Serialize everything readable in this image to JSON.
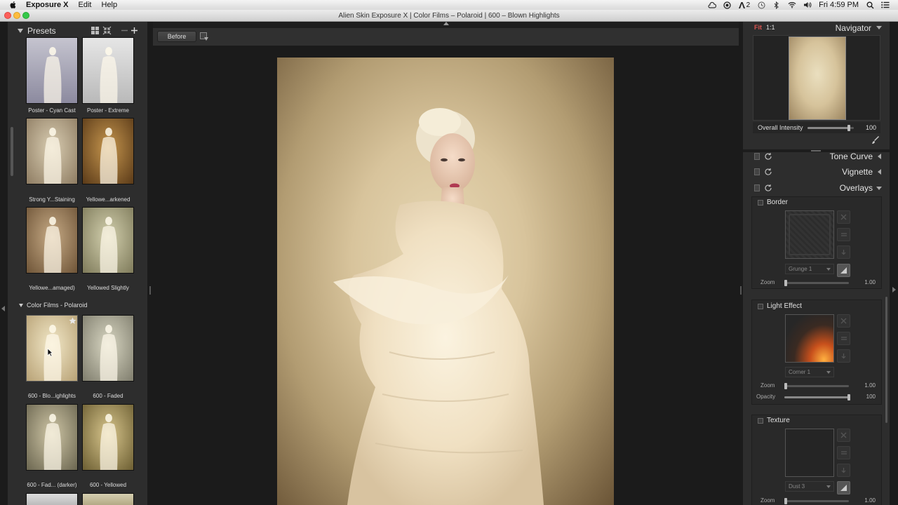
{
  "menubar": {
    "app_name": "Exposure X",
    "menus": [
      "Edit",
      "Help"
    ],
    "tray_number": "2",
    "clock": "Fri 4:59 PM"
  },
  "window": {
    "title": "Alien Skin Exposure X | Color Films – Polaroid | 600 – Blown Highlights"
  },
  "presets": {
    "title": "Presets",
    "top_rows": [
      {
        "left": "Poster - Cyan Cast",
        "right": "Poster - Extreme"
      },
      {
        "left": "Strong Y...Staining",
        "right": "Yellowe...arkened"
      },
      {
        "left": "Yellowe...amaged)",
        "right": "Yellowed Slightly"
      }
    ],
    "section_name": "Color Films - Polaroid",
    "section_rows": [
      {
        "left": "600 - Blo...ighlights",
        "right": "600 - Faded"
      },
      {
        "left": "600 - Fad... (darker)",
        "right": "600 - Yellowed"
      }
    ]
  },
  "toolbar": {
    "before_label": "Before"
  },
  "navigator": {
    "fit_label": "Fit",
    "ratio_label": "1:1",
    "title": "Navigator",
    "intensity_label": "Overall Intensity",
    "intensity_value": "100",
    "intensity_level": 0.9
  },
  "sections": {
    "tone_curve": "Tone Curve",
    "vignette": "Vignette",
    "overlays": "Overlays"
  },
  "overlays": {
    "border": {
      "title": "Border",
      "preset": "Grunge 1",
      "zoom_label": "Zoom",
      "zoom_value": "1.00",
      "zoom_level": 0.0
    },
    "light_effect": {
      "title": "Light Effect",
      "preset": "Corner 1",
      "zoom_label": "Zoom",
      "zoom_value": "1.00",
      "zoom_level": 0.0,
      "opacity_label": "Opacity",
      "opacity_value": "100",
      "opacity_level": 1.0
    },
    "texture": {
      "title": "Texture",
      "preset": "Dust 3",
      "zoom_label": "Zoom",
      "zoom_value": "1.00",
      "zoom_level": 0.0
    }
  },
  "colors": {
    "accent_fit": "#d9534f",
    "panel_bg": "#2d2d2d",
    "canvas_bg": "#1b1b1b"
  }
}
